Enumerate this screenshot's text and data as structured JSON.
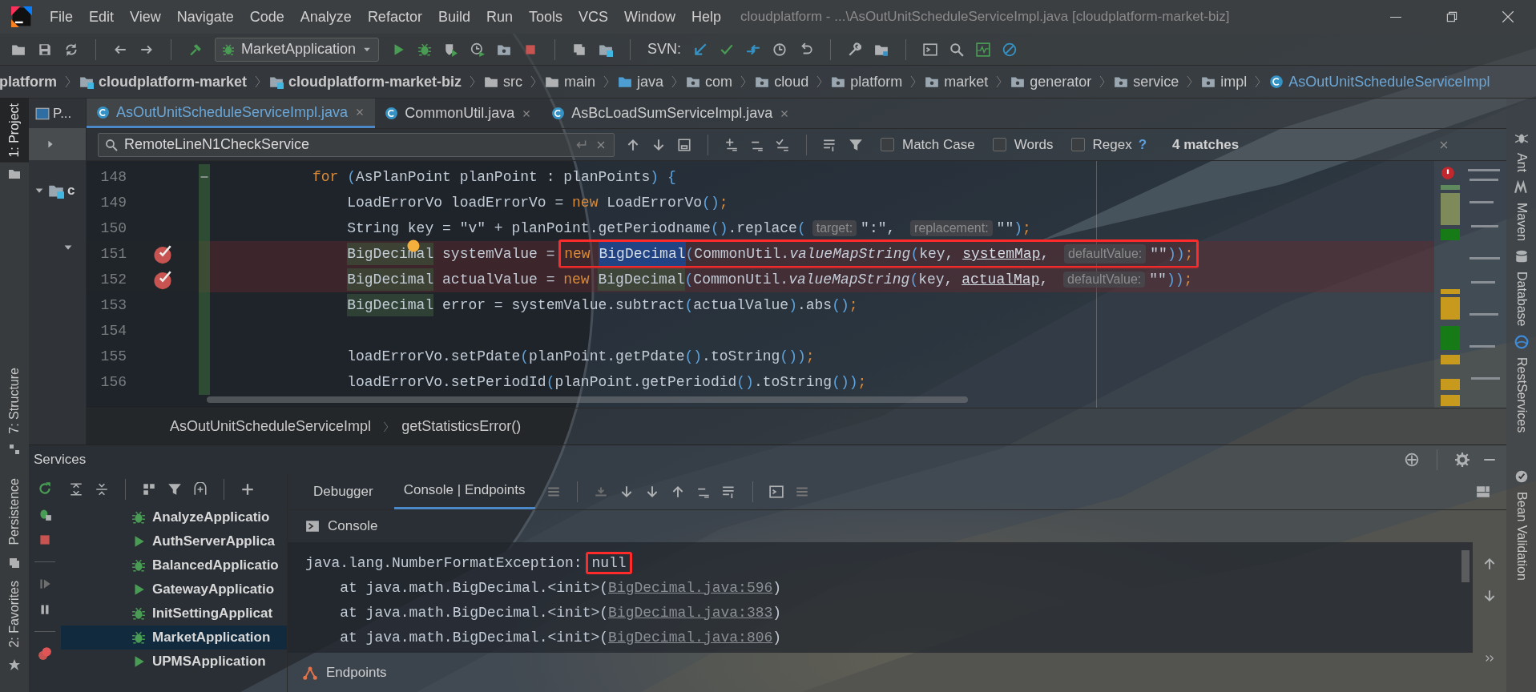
{
  "window": {
    "title": "cloudplatform - ...\\AsOutUnitScheduleServiceImpl.java [cloudplatform-market-biz]"
  },
  "menu": [
    "File",
    "Edit",
    "View",
    "Navigate",
    "Code",
    "Analyze",
    "Refactor",
    "Build",
    "Run",
    "Tools",
    "VCS",
    "Window",
    "Help"
  ],
  "toolbar": {
    "run_configuration": "MarketApplication",
    "svn_label": "SVN:"
  },
  "navigation_bar": [
    {
      "label": "platform",
      "kind": "plain"
    },
    {
      "label": "cloudplatform-market",
      "kind": "module"
    },
    {
      "label": "cloudplatform-market-biz",
      "kind": "module"
    },
    {
      "label": "src",
      "kind": "folder"
    },
    {
      "label": "main",
      "kind": "folder"
    },
    {
      "label": "java",
      "kind": "source"
    },
    {
      "label": "com",
      "kind": "package"
    },
    {
      "label": "cloud",
      "kind": "package"
    },
    {
      "label": "platform",
      "kind": "package"
    },
    {
      "label": "market",
      "kind": "package"
    },
    {
      "label": "generator",
      "kind": "package"
    },
    {
      "label": "service",
      "kind": "package"
    },
    {
      "label": "impl",
      "kind": "package"
    },
    {
      "label": "AsOutUnitScheduleServiceImpl",
      "kind": "class"
    }
  ],
  "left_stripe": {
    "top": [
      {
        "label": "1: Project",
        "selected": true
      }
    ],
    "middle": [
      {
        "label": "7: Structure",
        "selected": false
      }
    ],
    "bottom": [
      {
        "label": "Persistence",
        "selected": false
      },
      {
        "label": "2: Favorites",
        "selected": false
      }
    ]
  },
  "project_pane": {
    "title": "P...",
    "tree": [
      {
        "label": "c",
        "expanded": true
      }
    ]
  },
  "editor": {
    "tabs": [
      {
        "label": "AsOutUnitScheduleServiceImpl.java",
        "selected": true
      },
      {
        "label": "CommonUtil.java",
        "selected": false
      },
      {
        "label": "AsBcLoadSumServiceImpl.java",
        "selected": false
      }
    ],
    "search": {
      "value": "RemoteLineN1CheckService",
      "options": [
        {
          "label": "Match Case",
          "checked": false
        },
        {
          "label": "Words",
          "checked": false
        },
        {
          "label": "Regex",
          "checked": false
        }
      ],
      "help": "?",
      "matches": "4 matches"
    },
    "lines": [
      {
        "number": "148",
        "indented": false,
        "breakpoint": false,
        "intention": false,
        "tokens": [
          {
            "text": "for ",
            "kind": "keyword"
          },
          {
            "text": "(",
            "kind": "bracket"
          },
          {
            "text": "AsPlanPoint planPoint : planPoints",
            "kind": "plain"
          },
          {
            "text": ")",
            "kind": "bracket"
          },
          {
            "text": " {",
            "kind": "bracket"
          }
        ]
      },
      {
        "number": "149",
        "indented": true,
        "breakpoint": false,
        "intention": false,
        "tokens": [
          {
            "text": "LoadErrorVo loadErrorVo = ",
            "kind": "plain"
          },
          {
            "text": "new ",
            "kind": "keyword"
          },
          {
            "text": "LoadErrorVo",
            "kind": "plain"
          },
          {
            "text": "()",
            "kind": "bracket"
          },
          {
            "text": ";",
            "kind": "semicolon"
          }
        ]
      },
      {
        "number": "150",
        "indented": true,
        "breakpoint": false,
        "intention": false,
        "tokens": [
          {
            "text": "String key = \"v\" + planPoint.getPeriodname",
            "kind": "plain"
          },
          {
            "text": "()",
            "kind": "bracket"
          },
          {
            "text": ".replace",
            "kind": "plain"
          },
          {
            "text": "(",
            "kind": "bracket"
          },
          {
            "text": "target:",
            "kind": "hint"
          },
          {
            "text": "\":\", ",
            "kind": "plain"
          },
          {
            "text": "replacement:",
            "kind": "hint"
          },
          {
            "text": "\"\"",
            "kind": "plain"
          },
          {
            "text": ")",
            "kind": "bracket"
          },
          {
            "text": ";",
            "kind": "semicolon"
          }
        ]
      },
      {
        "number": "151",
        "indented": true,
        "breakpoint": true,
        "intention": true,
        "tokens": [
          {
            "text": "BigDecimal",
            "kind": "usage"
          },
          {
            "text": " systemValue = ",
            "kind": "plain"
          }
        ],
        "boxed": [
          {
            "text": "new ",
            "kind": "keyword"
          },
          {
            "text": "BigDecimal",
            "kind": "selection"
          },
          {
            "text": "(",
            "kind": "bracket"
          },
          {
            "text": "CommonUtil.",
            "kind": "plain"
          },
          {
            "text": "valueMapString",
            "kind": "static"
          },
          {
            "text": "(",
            "kind": "bracket"
          },
          {
            "text": "key, ",
            "kind": "plain"
          },
          {
            "text": "systemMap",
            "kind": "field"
          },
          {
            "text": ", ",
            "kind": "plain"
          },
          {
            "text": "defaultValue:",
            "kind": "hint"
          },
          {
            "text": "\"\"",
            "kind": "plain"
          },
          {
            "text": "))",
            "kind": "bracket"
          },
          {
            "text": ";",
            "kind": "semicolon"
          }
        ]
      },
      {
        "number": "152",
        "indented": true,
        "breakpoint": true,
        "intention": false,
        "tokens": [
          {
            "text": "BigDecimal",
            "kind": "usage"
          },
          {
            "text": " actualValue = ",
            "kind": "plain"
          },
          {
            "text": "new ",
            "kind": "keyword"
          },
          {
            "text": "BigDecimal",
            "kind": "usage"
          },
          {
            "text": "(",
            "kind": "bracket"
          },
          {
            "text": "CommonUtil.",
            "kind": "plain"
          },
          {
            "text": "valueMapString",
            "kind": "static"
          },
          {
            "text": "(",
            "kind": "bracket"
          },
          {
            "text": "key, ",
            "kind": "plain"
          },
          {
            "text": "actualMap",
            "kind": "field"
          },
          {
            "text": ", ",
            "kind": "plain"
          },
          {
            "text": "defaultValue:",
            "kind": "hint"
          },
          {
            "text": "\"\"",
            "kind": "plain"
          },
          {
            "text": "))",
            "kind": "bracket"
          },
          {
            "text": ";",
            "kind": "semicolon"
          }
        ]
      },
      {
        "number": "153",
        "indented": true,
        "breakpoint": false,
        "intention": false,
        "tokens": [
          {
            "text": "BigDecimal",
            "kind": "usage"
          },
          {
            "text": " error = systemValue.subtract",
            "kind": "plain"
          },
          {
            "text": "(",
            "kind": "bracket"
          },
          {
            "text": "actualValue",
            "kind": "plain"
          },
          {
            "text": ")",
            "kind": "bracket"
          },
          {
            "text": ".abs",
            "kind": "plain"
          },
          {
            "text": "()",
            "kind": "bracket"
          },
          {
            "text": ";",
            "kind": "semicolon"
          }
        ]
      },
      {
        "number": "154",
        "breakpoint": false,
        "intention": false
      },
      {
        "number": "155",
        "indented": true,
        "breakpoint": false,
        "intention": false,
        "tokens": [
          {
            "text": "loadErrorVo.setPdate",
            "kind": "plain"
          },
          {
            "text": "(",
            "kind": "bracket"
          },
          {
            "text": "planPoint.getPdate",
            "kind": "plain"
          },
          {
            "text": "()",
            "kind": "bracket"
          },
          {
            "text": ".toString",
            "kind": "plain"
          },
          {
            "text": "())",
            "kind": "bracket"
          },
          {
            "text": ";",
            "kind": "semicolon"
          }
        ]
      },
      {
        "number": "156",
        "indented": true,
        "breakpoint": false,
        "intention": false,
        "tokens": [
          {
            "text": "loadErrorVo.setPeriodId",
            "kind": "plain"
          },
          {
            "text": "(",
            "kind": "bracket"
          },
          {
            "text": "planPoint.getPeriodid",
            "kind": "plain"
          },
          {
            "text": "()",
            "kind": "bracket"
          },
          {
            "text": ".toString",
            "kind": "plain"
          },
          {
            "text": "())",
            "kind": "bracket"
          },
          {
            "text": ";",
            "kind": "semicolon"
          }
        ]
      }
    ],
    "breadcrumbs": [
      "AsOutUnitScheduleServiceImpl",
      "getStatisticsError()"
    ]
  },
  "services": {
    "title": "Services",
    "tree": [
      {
        "label": "AnalyzeApplicatio",
        "kind": "debug",
        "selected": false
      },
      {
        "label": "AuthServerApplica",
        "kind": "run",
        "selected": false
      },
      {
        "label": "BalancedApplicatio",
        "kind": "debug",
        "selected": false
      },
      {
        "label": "GatewayApplicatio",
        "kind": "run",
        "selected": false
      },
      {
        "label": "InitSettingApplicat",
        "kind": "debug",
        "selected": false
      },
      {
        "label": "MarketApplication",
        "kind": "debug",
        "selected": true
      },
      {
        "label": "UPMSApplication",
        "kind": "run",
        "selected": false
      }
    ],
    "tabs": [
      {
        "label": "Debugger",
        "selected": false
      },
      {
        "label": "Console | Endpoints",
        "selected": true
      }
    ],
    "console_title": "Console",
    "console_lines": [
      {
        "indented": false,
        "tokens": [
          {
            "text": "java.lang.NumberFormatException: ",
            "kind": "plain"
          }
        ],
        "boxed": [
          {
            "text": "null",
            "kind": "plain"
          }
        ]
      },
      {
        "indented": true,
        "tokens": [
          {
            "text": "at java.math.BigDecimal.<init>(",
            "kind": "plain"
          },
          {
            "text": "BigDecimal.java:596",
            "kind": "link"
          },
          {
            "text": ")",
            "kind": "plain"
          }
        ]
      },
      {
        "indented": true,
        "tokens": [
          {
            "text": "at java.math.BigDecimal.<init>(",
            "kind": "plain"
          },
          {
            "text": "BigDecimal.java:383",
            "kind": "link"
          },
          {
            "text": ")",
            "kind": "plain"
          }
        ]
      },
      {
        "indented": true,
        "tokens": [
          {
            "text": "at java.math.BigDecimal.<init>(",
            "kind": "plain"
          },
          {
            "text": "BigDecimal.java:806",
            "kind": "link"
          },
          {
            "text": ")",
            "kind": "plain"
          }
        ]
      }
    ],
    "endpoints": "Endpoints"
  },
  "right_stripe": [
    "Ant",
    "Maven",
    "Database",
    "RestServices",
    "Bean Validation"
  ]
}
